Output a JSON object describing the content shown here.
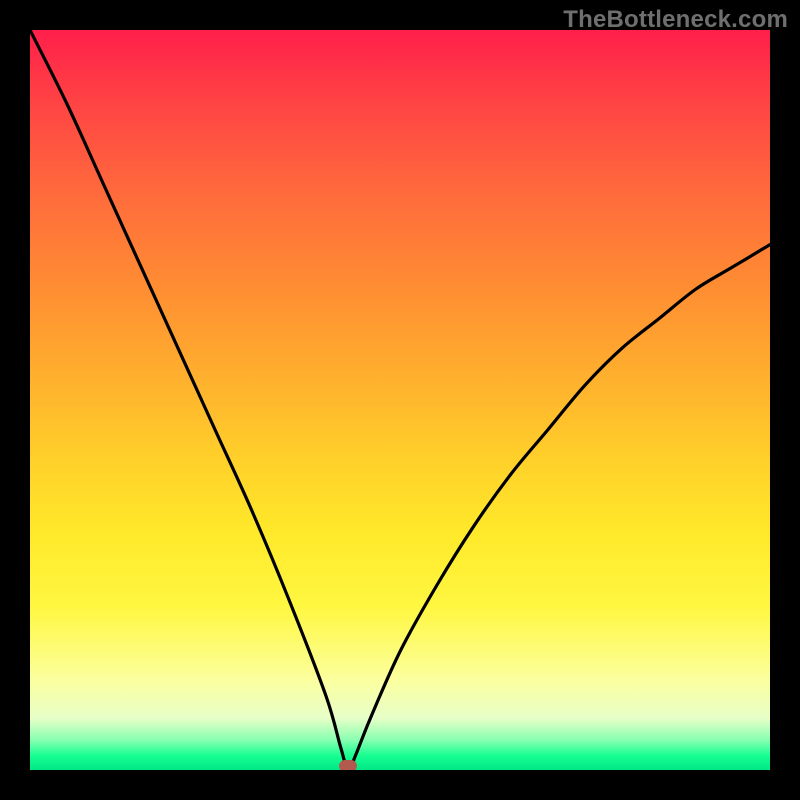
{
  "watermark": "TheBottleneck.com",
  "chart_data": {
    "type": "line",
    "title": "",
    "xlabel": "",
    "ylabel": "",
    "xlim": [
      0,
      100
    ],
    "ylim": [
      0,
      100
    ],
    "note": "Bottleneck curve: value reaches ~0 near x≈43 (optimal balance), rises steeply on both sides indicating bottleneck severity. Background gradient encodes severity (green=0 at bottom, red=100 at top).",
    "series": [
      {
        "name": "bottleneck-curve",
        "x": [
          0,
          5,
          10,
          15,
          20,
          25,
          30,
          35,
          40,
          42,
          43,
          44,
          46,
          50,
          55,
          60,
          65,
          70,
          75,
          80,
          85,
          90,
          95,
          100
        ],
        "values": [
          100,
          90,
          79,
          68,
          57,
          46,
          35,
          23,
          10,
          3,
          0,
          2,
          7,
          16,
          25,
          33,
          40,
          46,
          52,
          57,
          61,
          65,
          68,
          71
        ]
      }
    ],
    "marker": {
      "x": 43,
      "y": 0,
      "label": "optimal-point"
    },
    "gradient_stops": [
      {
        "pos": 0,
        "color": "#ff1f4a"
      },
      {
        "pos": 50,
        "color": "#ffd02a"
      },
      {
        "pos": 95,
        "color": "#e7ffc8"
      },
      {
        "pos": 100,
        "color": "#00e886"
      }
    ]
  }
}
